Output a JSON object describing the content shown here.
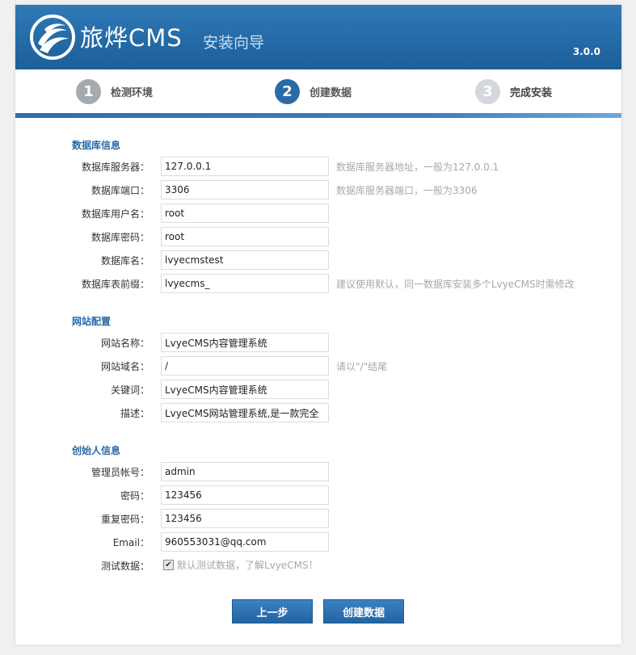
{
  "header": {
    "brand": "旅烨CMS",
    "subtitle": "安装向导",
    "version": "3.0.0",
    "logo_icon": "swirl-logo-icon",
    "colors": {
      "header": "#2a72b2",
      "accent": "#2b6aa8"
    }
  },
  "steps": [
    {
      "number": "1",
      "label": "检测环境",
      "state": "done"
    },
    {
      "number": "2",
      "label": "创建数据",
      "state": "active"
    },
    {
      "number": "3",
      "label": "完成安装",
      "state": "todo"
    }
  ],
  "database": {
    "title": "数据库信息",
    "host": {
      "label": "数据库服务器：",
      "value": "127.0.0.1",
      "hint": "数据库服务器地址，一般为127.0.0.1"
    },
    "port": {
      "label": "数据库端口：",
      "value": "3306",
      "hint": "数据库服务器端口，一般为3306"
    },
    "user": {
      "label": "数据库用户名：",
      "value": "root"
    },
    "password": {
      "label": "数据库密码：",
      "value": "root"
    },
    "name": {
      "label": "数据库名：",
      "value": "lvyecmstest"
    },
    "prefix": {
      "label": "数据库表前缀：",
      "value": "lvyecms_",
      "hint": "建议使用默认，同一数据库安装多个LvyeCMS时需修改"
    }
  },
  "site": {
    "title": "网站配置",
    "name": {
      "label": "网站名称：",
      "value": "LvyeCMS内容管理系统"
    },
    "domain": {
      "label": "网站域名：",
      "value": "/",
      "hint": "请以\"/\"结尾"
    },
    "keywords": {
      "label": "关键词：",
      "value": "LvyeCMS内容管理系统"
    },
    "description": {
      "label": "描述：",
      "value": "LvyeCMS网站管理系统,是一款完全"
    }
  },
  "founder": {
    "title": "创始人信息",
    "account": {
      "label": "管理员帐号：",
      "value": "admin"
    },
    "password": {
      "label": "密码：",
      "value": "123456"
    },
    "repeat_password": {
      "label": "重复密码：",
      "value": "123456"
    },
    "email": {
      "label": "Email：",
      "value": "960553031@qq.com"
    },
    "test_data": {
      "label": "测试数据：",
      "checked": true,
      "text": "默认测试数据，了解LvyeCMS！"
    }
  },
  "buttons": {
    "prev": "上一步",
    "create": "创建数据"
  }
}
